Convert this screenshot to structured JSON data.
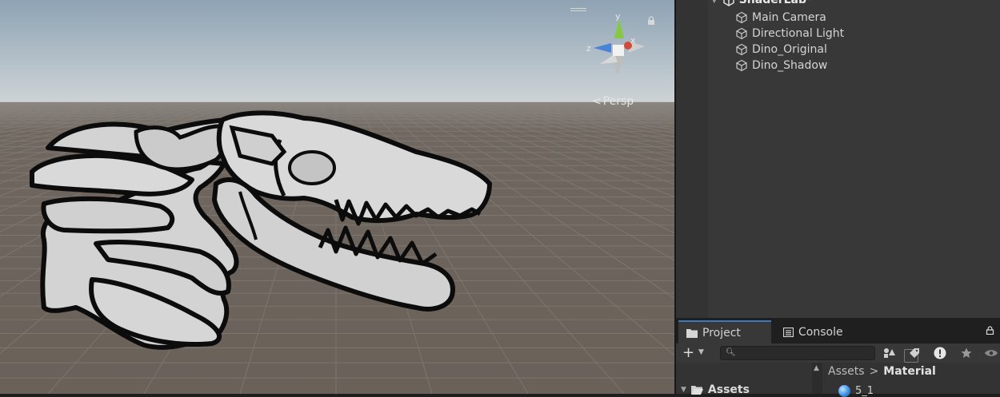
{
  "scene": {
    "view_mode": "Persp",
    "gizmo": {
      "x_label": "x",
      "y_label": "y",
      "z_label": "z"
    },
    "icons": {
      "menu": "hamburger-menu-icon",
      "lock": "lock-icon",
      "persp_arrow": "perspective-arrow-icon"
    }
  },
  "hierarchy": {
    "scene_name": "ShaderLab*",
    "items": [
      {
        "label": "Main Camera",
        "icon": "gameobject-cube-icon"
      },
      {
        "label": "Directional Light",
        "icon": "gameobject-cube-icon"
      },
      {
        "label": "Dino_Original",
        "icon": "gameobject-cube-icon"
      },
      {
        "label": "Dino_Shadow",
        "icon": "gameobject-cube-icon"
      }
    ]
  },
  "project": {
    "tabs": [
      {
        "label": "Project",
        "icon": "folder-icon",
        "active": true
      },
      {
        "label": "Console",
        "icon": "console-icon",
        "active": false
      }
    ],
    "search": {
      "value": "",
      "placeholder": ""
    },
    "tree": {
      "root_label": "Assets"
    },
    "breadcrumb": {
      "root": "Assets",
      "separator": ">",
      "current": "Material"
    },
    "items": [
      {
        "label": "5_1",
        "icon": "material-sphere-icon"
      }
    ]
  },
  "colors": {
    "sky_top": "#8aa0b3",
    "sky_horizon": "#c9d0d4",
    "ground": "#6b625b",
    "panel": "#383838",
    "accent": "#3a79bb"
  }
}
